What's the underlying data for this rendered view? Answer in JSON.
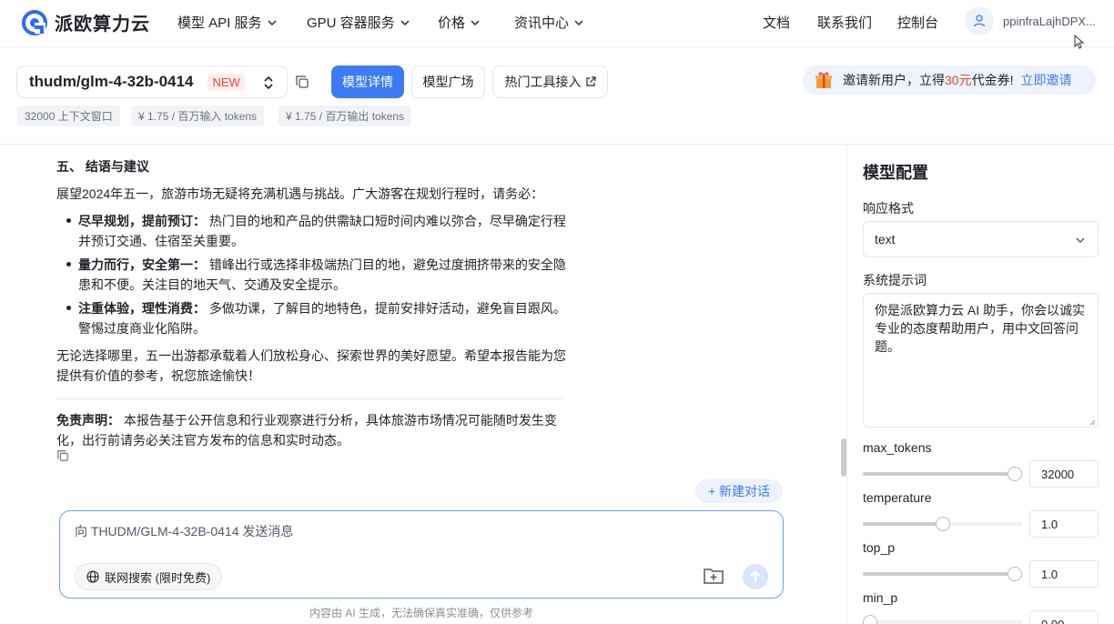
{
  "brand": {
    "name": "派欧算力云"
  },
  "nav": {
    "items": [
      {
        "label": "模型 API 服务"
      },
      {
        "label": "GPU 容器服务"
      },
      {
        "label": "价格"
      },
      {
        "label": "资讯中心"
      }
    ],
    "docs": "文档",
    "contact": "联系我们",
    "console": "控制台",
    "username": "ppinfraLajhDPX..."
  },
  "model": {
    "name": "thudm/glm-4-32b-0414",
    "new_tag": "NEW",
    "detail_button": "模型详情",
    "square_button": "模型广场",
    "tools_button": "热门工具接入",
    "chips": [
      "32000 上下文窗口",
      "¥ 1.75 / 百万输入 tokens",
      "¥ 1.75 / 百万输出 tokens"
    ]
  },
  "invite": {
    "text_before": "邀请新用户，立得 ",
    "amount": "30元",
    "text_after": " 代金券!",
    "link": "立即邀请"
  },
  "message": {
    "heading": "五、 结语与建议",
    "intro": "展望2024年五一，旅游市场无疑将充满机遇与挑战。广大游客在规划行程时，请务必：",
    "bullets": [
      {
        "title": "尽早规划，提前预订：",
        "text": " 热门目的地和产品的供需缺口短时间内难以弥合，尽早确定行程并预订交通、住宿至关重要。"
      },
      {
        "title": "量力而行，安全第一：",
        "text": " 错峰出行或选择非极端热门目的地，避免过度拥挤带来的安全隐患和不便。关注目的地天气、交通及安全提示。"
      },
      {
        "title": "注重体验，理性消费：",
        "text": " 多做功课，了解目的地特色，提前安排好活动，避免盲目跟风。警惕过度商业化陷阱。"
      }
    ],
    "closing": "无论选择哪里，五一出游都承载着人们放松身心、探索世界的美好愿望。希望本报告能为您提供有价值的参考，祝您旅途愉快！",
    "disclaimer_title": "免责声明：",
    "disclaimer_text": " 本报告基于公开信息和行业观察进行分析，具体旅游市场情况可能随时发生变化，出行前请务必关注官方发布的信息和实时动态。"
  },
  "chat": {
    "new_chat": "+ 新建对话",
    "placeholder": "向 THUDM/GLM-4-32B-0414 发送消息",
    "web_search": "联网搜索 (限时免费)",
    "footer": "内容由 AI 生成，无法确保真实准确，仅供参考"
  },
  "config": {
    "title": "模型配置",
    "response_format_label": "响应格式",
    "response_format_value": "text",
    "system_prompt_label": "系统提示词",
    "system_prompt_value": "你是派欧算力云 AI 助手，你会以诚实专业的态度帮助用户，用中文回答问题。",
    "params": [
      {
        "label": "max_tokens",
        "value": "32000",
        "fraction": 1.0
      },
      {
        "label": "temperature",
        "value": "1.0",
        "fraction": 0.5
      },
      {
        "label": "top_p",
        "value": "1.0",
        "fraction": 1.0
      },
      {
        "label": "min_p",
        "value": "0.00",
        "fraction": 0.0
      }
    ]
  }
}
